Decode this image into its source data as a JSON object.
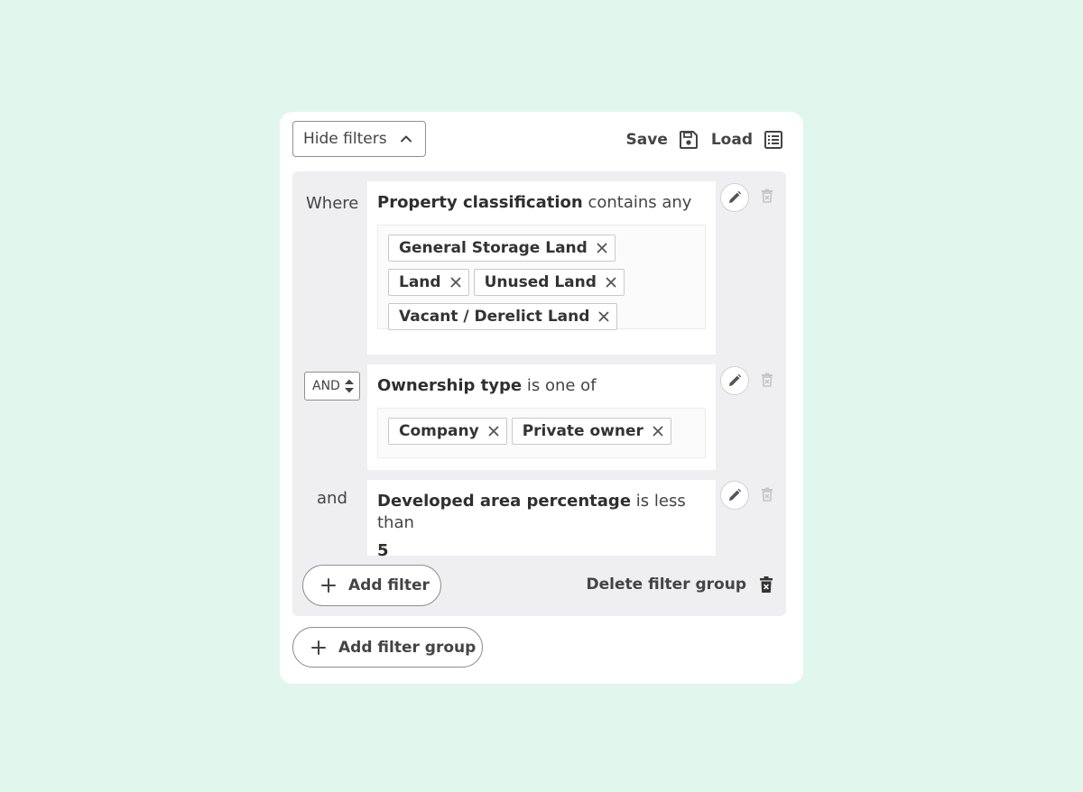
{
  "toolbar": {
    "hide_filters_label": "Hide filters",
    "save_label": "Save",
    "load_label": "Load"
  },
  "filters": [
    {
      "conjunction": "Where",
      "field": "Property classification",
      "operator": "contains any",
      "chips": [
        "General Storage Land",
        "Land",
        "Unused Land",
        "Vacant / Derelict Land"
      ]
    },
    {
      "conjunction": "AND",
      "field": "Ownership type",
      "operator": "is one of",
      "chips": [
        "Company",
        "Private owner"
      ]
    },
    {
      "conjunction": "and",
      "field": "Developed area percentage",
      "operator": "is less than",
      "value": "5"
    }
  ],
  "group_actions": {
    "add_filter_label": "Add filter",
    "delete_group_label": "Delete filter group"
  },
  "add_group_label": "Add filter group",
  "icons": {
    "chevron": "chevron-up-icon",
    "save": "floppy-disk-icon",
    "load": "list-icon",
    "edit": "pencil-icon",
    "delete": "trash-icon",
    "remove_chip": "close-icon",
    "add": "plus-icon"
  },
  "colors": {
    "background": "#e1f6ec",
    "panel": "#ffffff",
    "group": "#efeff1",
    "text": "#444444"
  }
}
